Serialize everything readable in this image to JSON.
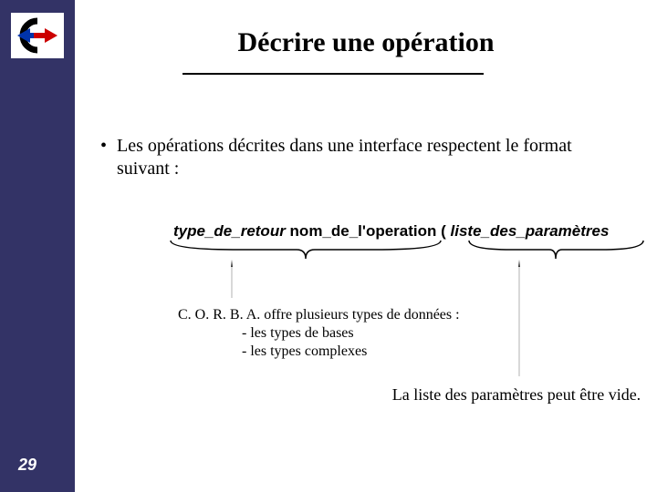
{
  "logo": {
    "alt": "C logo"
  },
  "title": "Décrire une opération",
  "bullet": "Les opérations décrites dans une interface respectent le format suivant :",
  "syntax": {
    "return_type": "type_de_retour",
    "op_name": " nom_de_l'operation ",
    "open_paren": "( ",
    "param_list": "liste_des_paramètres"
  },
  "corba_note": {
    "line1": "C. O. R. B. A. offre plusieurs types de données :",
    "line2": "- les types de bases",
    "line3": "- les types complexes"
  },
  "param_note": "La liste des paramètres peut être vide.",
  "page_number": "29"
}
